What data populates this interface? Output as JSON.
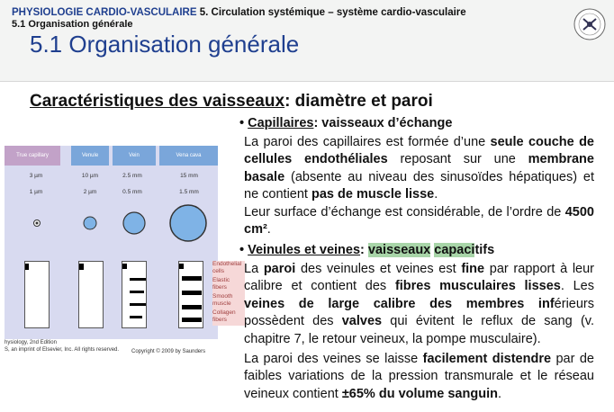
{
  "header": {
    "course": "PHYSIOLOGIE CARDIO-VASCULAIRE",
    "chapter": "5. Circulation systémique – système cardio-vasculaire",
    "section": "5.1 Organisation générale"
  },
  "slide_title": "5.1 Organisation générale",
  "subtitle": {
    "underlined": "Caractéristiques des vaisseaux",
    "rest": ": diamètre et paroi"
  },
  "capillaires": {
    "bullet_term": "Capillaires",
    "bullet_rest": ": vaisseaux d’échange",
    "p1": [
      "La paroi des capillaires est formée d’une ",
      "seule couche de cellules endothéliales",
      " reposant sur une ",
      "membrane basale",
      " (absente au niveau des sinusoïdes hépatiques) et ne contient ",
      "pas de muscle lisse",
      "."
    ],
    "p2": [
      "Leur surface d’échange est considérable, de l’ordre de ",
      "4500 cm²",
      "."
    ]
  },
  "veines": {
    "bullet_term": "Veinules et veines",
    "bullet_colon": ": ",
    "bullet_hl1": "vaisseaux",
    "bullet_hl2": "capaci",
    "bullet_end": "tifs",
    "p1": [
      "La ",
      "paroi",
      " des veinules et veines est ",
      "fine",
      " par rapport à leur calibre et contient des ",
      "fibres musculaires lisses",
      ". Les ",
      "veines de large calibre des membres inf",
      "ér",
      "ieurs possèdent des ",
      "valves",
      " qui évitent le reflux de sang (v. chapitre 7, le retour veineux, la pompe musculaire)."
    ],
    "p2": [
      "La paroi des veines se laisse ",
      "facilement distendre",
      " par de faibles variations de la pression transmurale et le réseau veineux contient ",
      "±65% du volume sanguin",
      "."
    ]
  },
  "figure": {
    "columns": [
      "True capillary",
      "Venule",
      "Vein",
      "Vena cava"
    ],
    "lumen_diameter": [
      "3 µm",
      "10 µm",
      "2.5 mm",
      "15 mm"
    ],
    "wall_thickness": [
      "1 µm",
      "2 µm",
      "0.5 mm",
      "1.5 mm"
    ],
    "legend": [
      "Endothelial cells",
      "Elastic fibers",
      "Smooth muscle",
      "Collagen fibers"
    ],
    "caption_left_1": "hysiology, 2nd Edition",
    "caption_left_2": "S, an imprint of Elsevier, Inc. All rights reserved.",
    "caption_right": "Copyright © 2009 by Saunders",
    "colors": {
      "header_blue": "#7aa6da",
      "header_purple": "#c2a2c8",
      "circle_blue": "#7fb3e6",
      "panel": "#d8daf0"
    }
  },
  "logo": "university-seal-icon"
}
